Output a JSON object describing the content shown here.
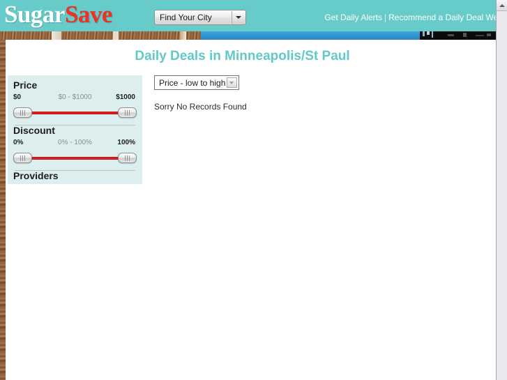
{
  "header": {
    "logo_primary": "Sugar",
    "logo_accent": "Save",
    "city_select": {
      "value": "Find Your City",
      "options": [
        "Find Your City"
      ]
    },
    "nav": {
      "alerts_label": "Get Daily Alerts",
      "separator": "|",
      "recommend_label": "Recommend a Daily Deal Webs"
    }
  },
  "page": {
    "title": "Daily Deals in Minneapolis/St Paul"
  },
  "sidebar": {
    "price": {
      "title": "Price",
      "min_label": "$0",
      "range_label": "$0 - $1000",
      "max_label": "$1000"
    },
    "discount": {
      "title": "Discount",
      "min_label": "0%",
      "range_label": "0% - 100%",
      "max_label": "100%"
    },
    "providers": {
      "title": "Providers"
    }
  },
  "content": {
    "sort_select": {
      "value": "Price - low to high",
      "options": [
        "Price - low to high"
      ]
    },
    "empty_message": "Sorry No Records Found"
  },
  "colors": {
    "header_teal": "#67cbc9",
    "logo_red": "#ee3124",
    "title_teal": "#64c8c8",
    "sidebar_bg": "#ddeeee",
    "slider_bar_red": "#e02020",
    "banner_blue": "#2f93d1",
    "wood_brown": "#8a5a36"
  }
}
